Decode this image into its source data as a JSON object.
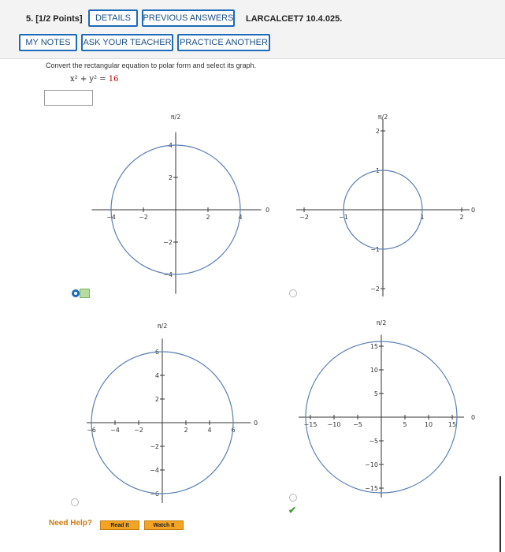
{
  "header": {
    "points": "5.  [1/2 Points]",
    "details_label": "DETAILS",
    "previous_answers_label": "PREVIOUS ANSWERS",
    "code": "LARCALCET7 10.4.025.",
    "my_notes_label": "MY NOTES",
    "ask_teacher_label": "ASK YOUR TEACHER",
    "practice_another_label": "PRACTICE ANOTHER"
  },
  "question": {
    "prompt": "Convert the rectangular equation to polar form and select its graph.",
    "eq_lhs": "x² + y² = ",
    "eq_rhs": "16",
    "answer_value": ""
  },
  "options": [
    {
      "id": "a",
      "selected": true,
      "mark": "",
      "top_label": "π/2",
      "right_label": "0",
      "radius": 4,
      "x_ticks": [
        -4,
        -2,
        2,
        4
      ],
      "y_ticks": [
        4,
        2,
        -2,
        -4
      ]
    },
    {
      "id": "b",
      "selected": false,
      "mark": "",
      "top_label": "π/2",
      "right_label": "0",
      "radius": 1,
      "x_ticks": [
        -2,
        -1,
        1,
        2
      ],
      "y_ticks": [
        2,
        1,
        -1,
        -2
      ]
    },
    {
      "id": "c",
      "selected": false,
      "mark": "",
      "top_label": "π/2",
      "right_label": "0",
      "radius": 6,
      "x_ticks": [
        -6,
        -4,
        -2,
        2,
        4,
        6
      ],
      "y_ticks": [
        6,
        4,
        2,
        -2,
        -4,
        -6
      ]
    },
    {
      "id": "d",
      "selected": false,
      "mark": "✔",
      "top_label": "π/2",
      "right_label": "0",
      "radius": 16,
      "x_ticks": [
        -15,
        -10,
        -5,
        5,
        10,
        15
      ],
      "y_ticks": [
        15,
        10,
        5,
        -5,
        -10,
        -15
      ]
    }
  ],
  "help": {
    "need_help": "Need Help?",
    "read_it": "Read It",
    "watch_it": "Watch It"
  },
  "colors": {
    "accent": "#1e6bb8",
    "circle": "#5b7fb5",
    "correct": "#3d9c2f",
    "help_button": "#f4a425"
  }
}
